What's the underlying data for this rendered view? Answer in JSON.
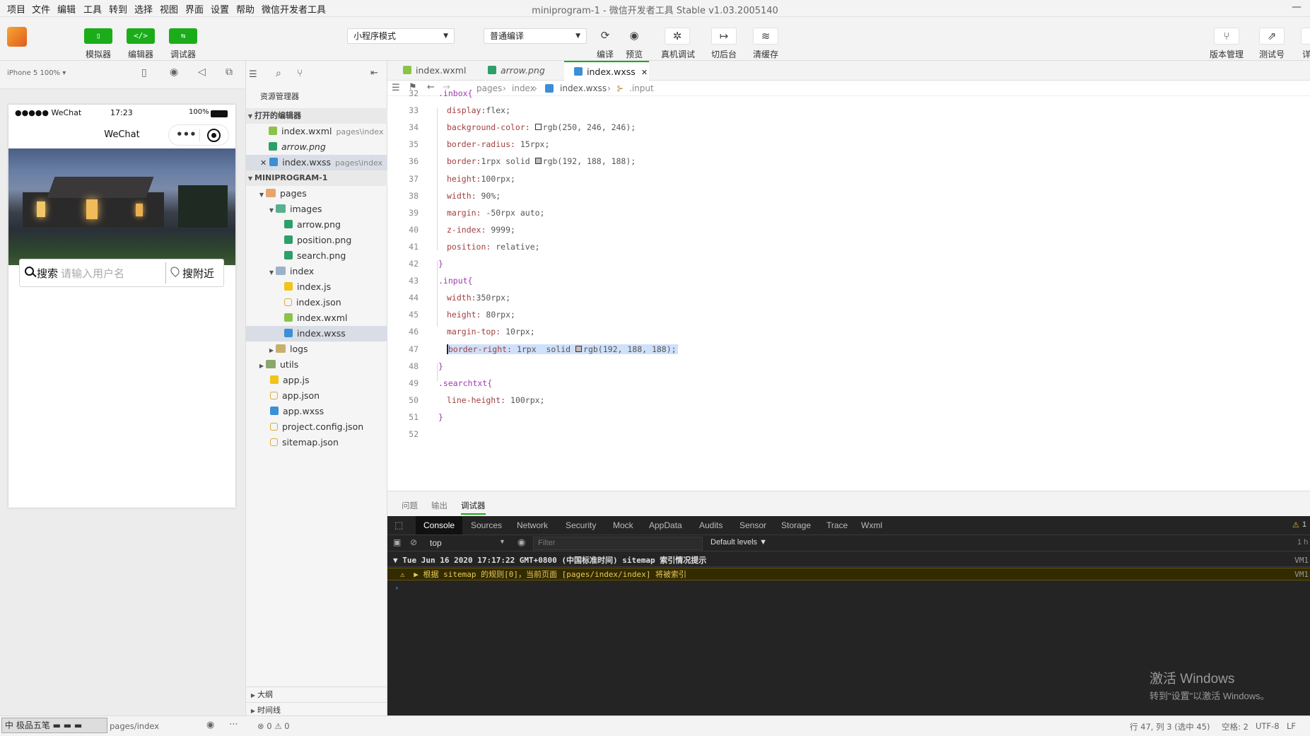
{
  "menu": [
    "项目",
    "文件",
    "编辑",
    "工具",
    "转到",
    "选择",
    "视图",
    "界面",
    "设置",
    "帮助",
    "微信开发者工具"
  ],
  "window_title": "miniprogram-1 - 微信开发者工具 Stable v1.03.2005140",
  "window_min": "—",
  "toolbar": {
    "simulator": {
      "icon": "▯",
      "label": "模拟器"
    },
    "editor": {
      "icon": "</>",
      "label": "编辑器"
    },
    "debugger": {
      "icon": "⇆",
      "label": "调试器"
    },
    "mode": "小程序模式",
    "compile_mode": "普通编译",
    "compile": {
      "icon": "⟳",
      "label": "编译"
    },
    "preview": {
      "icon": "◉",
      "label": "预览"
    },
    "remote_debug": {
      "icon": "✲",
      "label": "真机调试"
    },
    "background": {
      "icon": "↦",
      "label": "切后台"
    },
    "clear_cache": {
      "icon": "≋",
      "label": "清缓存"
    },
    "version": {
      "icon": "⑂",
      "label": "版本管理"
    },
    "test": {
      "icon": "⇗",
      "label": "测试号"
    },
    "details": {
      "icon": "",
      "label": "详"
    }
  },
  "simulator": {
    "device": "iPhone 5 100% ▾",
    "status_signal": "●●●●● WeChat",
    "status_time": "17:23",
    "status_battery": "100%",
    "nav_title": "WeChat",
    "nav_more": "•••",
    "search_label": "搜索",
    "search_placeholder": "请输入用户名",
    "nearby_label": "搜附近"
  },
  "explorer": {
    "title": "资源管理器",
    "open_editors_section": "打开的编辑器",
    "open_editors": [
      {
        "name": "index.wxml",
        "path": "pages\\index",
        "type": "wxml"
      },
      {
        "name": "arrow.png",
        "path": "",
        "type": "png"
      },
      {
        "name": "index.wxss",
        "path": "pages\\index",
        "type": "wxss"
      }
    ],
    "project_section": "MINIPROGRAM-1",
    "tree": {
      "pages": "pages",
      "images": "images",
      "images_files": [
        "arrow.png",
        "position.png",
        "search.png"
      ],
      "index": "index",
      "index_files": [
        "index.js",
        "index.json",
        "index.wxml",
        "index.wxss"
      ],
      "logs": "logs",
      "utils": "utils",
      "root_files": [
        "app.js",
        "app.json",
        "app.wxss",
        "project.config.json",
        "sitemap.json"
      ]
    },
    "outline": "大纲",
    "timeline": "时间线"
  },
  "editor": {
    "tabs": [
      {
        "name": "index.wxml",
        "type": "wxml"
      },
      {
        "name": "arrow.png",
        "type": "png"
      },
      {
        "name": "index.wxss",
        "type": "wxss"
      }
    ],
    "breadcrumb": [
      "pages",
      "index",
      "index.wxss",
      ".input"
    ],
    "lines": [
      {
        "n": "32",
        "text": ".inbox{"
      },
      {
        "n": "33",
        "prop": "display",
        "val": "flex;"
      },
      {
        "n": "34",
        "prop": "background-color",
        "val": "rgb(250, 246, 246);",
        "swatch": "#faf6f6"
      },
      {
        "n": "35",
        "prop": "border-radius",
        "val": "15rpx;"
      },
      {
        "n": "36",
        "prop": "border",
        "val": "1rpx solid ",
        "val2": "rgb(192, 188, 188);",
        "swatch": "#c0bcbc"
      },
      {
        "n": "37",
        "prop": "height",
        "val": "100rpx;"
      },
      {
        "n": "38",
        "prop": "width",
        "val": "90%;"
      },
      {
        "n": "39",
        "prop": "margin",
        "val": "-50rpx auto;"
      },
      {
        "n": "40",
        "prop": "z-index",
        "val": "9999;"
      },
      {
        "n": "41",
        "prop": "position",
        "val": "relative;"
      },
      {
        "n": "42",
        "text": "}"
      },
      {
        "n": "43",
        "text": ".input{"
      },
      {
        "n": "44",
        "prop": "width",
        "val": "350rpx;"
      },
      {
        "n": "45",
        "prop": "height",
        "val": "80rpx;"
      },
      {
        "n": "46",
        "prop": "margin-top",
        "val": "10rpx;"
      },
      {
        "n": "47",
        "prop": "border-right",
        "val": "1rpx  solid ",
        "val2": "rgb(192, 188, 188);",
        "swatch": "#c0bcbc",
        "selected": true
      },
      {
        "n": "48",
        "text": "}"
      },
      {
        "n": "49",
        "text": ".searchtxt{"
      },
      {
        "n": "50",
        "prop": "line-height",
        "val": "100rpx;"
      },
      {
        "n": "51",
        "text": "}"
      },
      {
        "n": "52",
        "text": ""
      }
    ]
  },
  "panel": {
    "tabs": [
      "问题",
      "输出",
      "调试器"
    ],
    "devtools_tabs": [
      "Console",
      "Sources",
      "Network",
      "Security",
      "Mock",
      "AppData",
      "Audits",
      "Sensor",
      "Storage",
      "Trace",
      "Wxml"
    ],
    "warn_count": "1",
    "context": "top",
    "filter_placeholder": "Filter",
    "levels": "Default levels ▼",
    "hidden_count": "1 h",
    "log_header": "▼ Tue Jun 16 2020 17:17:22 GMT+0800 (中国标准时间) sitemap 索引情况提示",
    "log_warn": "▶ 根据 sitemap 的规则[0]，当前页面 [pages/index/index] 将被索引",
    "vm_ref": "VM1",
    "prompt": "›"
  },
  "watermark": {
    "title": "激活 Windows",
    "sub": "转到\"设置\"以激活 Windows。"
  },
  "statusbar": {
    "left_path": "pages/index",
    "errors": "⊗ 0 ⚠ 0",
    "cursor": "行 47, 列 3 (选中 45)",
    "spaces": "空格: 2",
    "encoding": "UTF-8",
    "eol": "LF",
    "ime": "中 极品五笔 ▬ ▬ ▬"
  },
  "colors": {
    "accent_green": "#1aad19",
    "selection": "#cfe0fb",
    "warn_bg": "#332b00",
    "warn_text": "#e8c95a"
  }
}
